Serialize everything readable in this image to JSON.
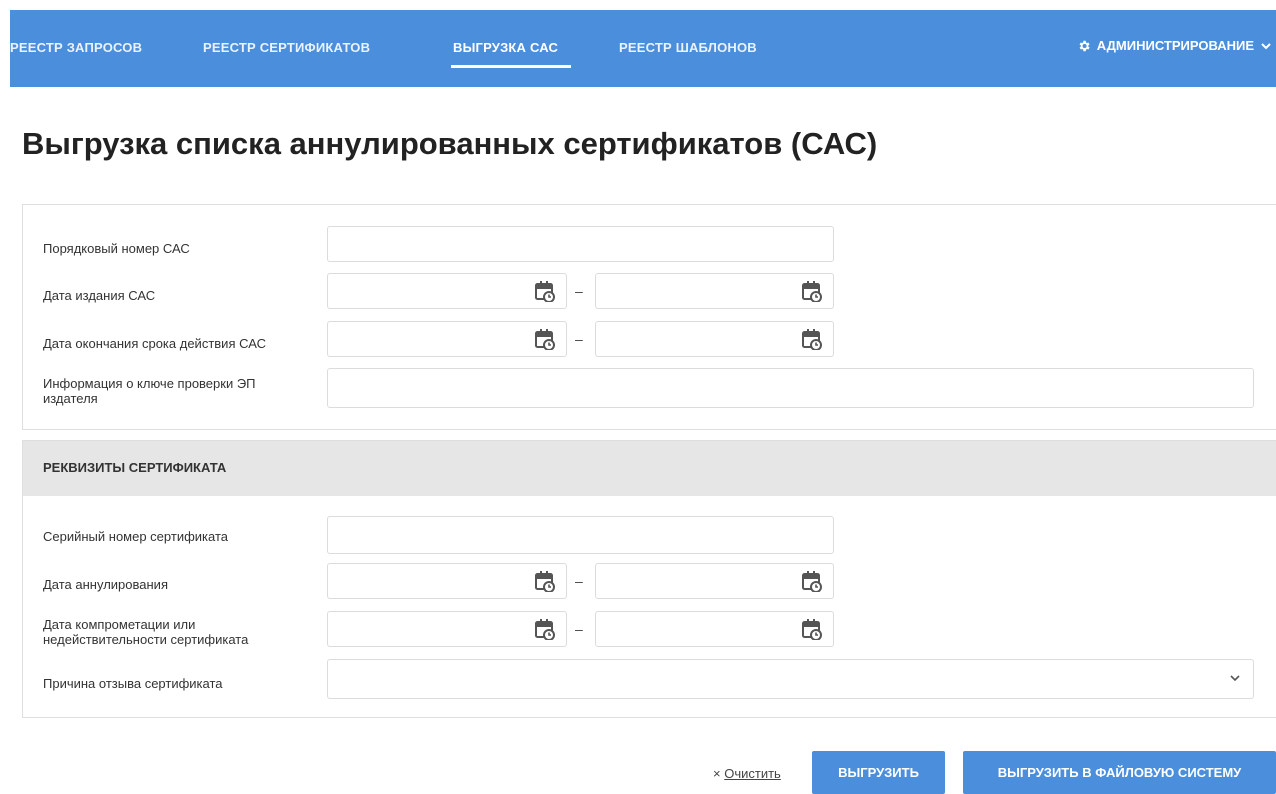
{
  "nav": {
    "items": [
      "РЕЕСТР ЗАПРОСОВ",
      "РЕЕСТР СЕРТИФИКАТОВ",
      "ВЫГРУЗКА САС",
      "РЕЕСТР ШАБЛОНОВ"
    ],
    "active_index": 2,
    "admin_label": "АДМИНИСТРИРОВАНИЕ",
    "admin_icon": "gear-icon",
    "admin_chevron": "chevron-down-icon"
  },
  "page": {
    "title": "Выгрузка списка аннулированных сертификатов (САС)"
  },
  "cas_form": {
    "serial_label": "Порядковый номер САС",
    "serial_value": "",
    "issue_date_label": "Дата издания САС",
    "issue_date_from": "",
    "issue_date_to": "",
    "expiry_date_label": "Дата окончания срока действия САС",
    "expiry_date_from": "",
    "expiry_date_to": "",
    "issuer_key_label_line1": "Информация о ключе проверки ЭП",
    "issuer_key_label_line2": "издателя",
    "issuer_key_value": ""
  },
  "cert_section": {
    "header": "РЕКВИЗИТЫ СЕРТИФИКАТА",
    "cert_serial_label": "Серийный номер сертификата",
    "cert_serial_value": "",
    "revocation_date_label": "Дата аннулирования",
    "compromise_label_line1": "Дата компрометации или",
    "compromise_label_line2": "недействительности сертификата",
    "reason_label": "Причина отзыва сертификата",
    "reason_value": ""
  },
  "range_separator": "–",
  "actions": {
    "clear_icon": "×",
    "clear_label": "Очистить",
    "export_label": "ВЫГРУЗИТЬ",
    "export_fs_label": "ВЫГРУЗИТЬ В ФАЙЛОВУЮ СИСТЕМУ"
  },
  "colors": {
    "accent": "#4b8fdc",
    "panel_header_bg": "#e6e6e6",
    "border": "#dcdcdc"
  }
}
